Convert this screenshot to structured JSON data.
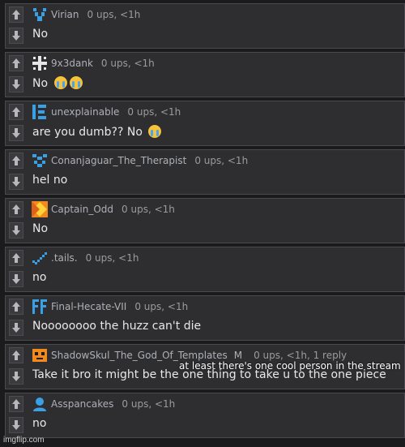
{
  "comments": [
    {
      "user": "Virian",
      "stats": "0 ups, <1h",
      "text": "No",
      "emoji_count": 0,
      "avatar_icon": "blue-pixel-v-avatar"
    },
    {
      "user": "9x3dank",
      "stats": "0 ups, <1h",
      "text": "No",
      "emoji_count": 2,
      "avatar_icon": "white-pixel-cross-avatar"
    },
    {
      "user": "unexplainable",
      "stats": "0 ups, <1h",
      "text": "are you dumb?? No",
      "emoji_count": 1,
      "avatar_icon": "blue-bracket-avatar"
    },
    {
      "user": "Conanjaguar_The_Therapist",
      "stats": "0 ups, <1h",
      "text": "hel no",
      "emoji_count": 0,
      "avatar_icon": "blue-pixel-avatar"
    },
    {
      "user": "Captain_Odd",
      "stats": "0 ups, <1h",
      "text": "No",
      "emoji_count": 0,
      "avatar_icon": "orange-diamond-avatar"
    },
    {
      "user": ".tails.",
      "stats": "0 ups, <1h",
      "text": "no",
      "emoji_count": 0,
      "avatar_icon": "blue-check-avatar"
    },
    {
      "user": "Final-Hecate-VII",
      "stats": "0 ups, <1h",
      "text": "Noooooooo the huzz can't die",
      "emoji_count": 0,
      "avatar_icon": "blue-ff-avatar"
    },
    {
      "user": "ShadowSkul_The_God_Of_Templates",
      "mod": "M",
      "stats": "0 ups, <1h, 1 reply",
      "text": "Take it bro it might be the one thing to take u to the one piece",
      "emoji_count": 0,
      "avatar_icon": "orange-skull-avatar"
    },
    {
      "user": "Asspancakes",
      "stats": "0 ups, <1h",
      "text": "no",
      "emoji_count": 0,
      "avatar_icon": "blue-person-avatar"
    }
  ],
  "overlay_text": "at least there's one cool person in the stream",
  "watermark": "imgflip.com",
  "colors": {
    "background": "#1b1b1d",
    "panel": "#2e2e31",
    "accent_blue": "#3aa0e6",
    "accent_orange": "#f08a1c"
  }
}
